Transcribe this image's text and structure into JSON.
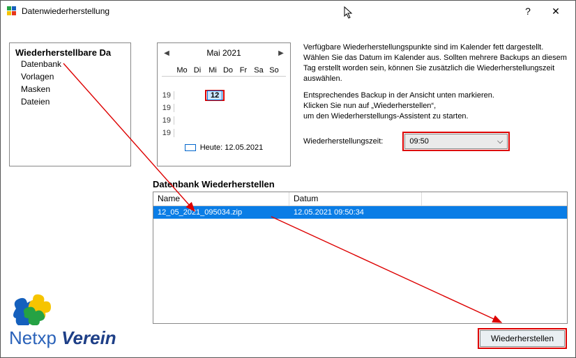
{
  "window": {
    "title": "Datenwiederherstellung",
    "help_symbol": "?",
    "close_symbol": "✕"
  },
  "tree": {
    "title": "Wiederherstellbare Da",
    "items": [
      "Datenbank",
      "Vorlagen",
      "Masken",
      "Dateien"
    ]
  },
  "calendar": {
    "month_label": "Mai 2021",
    "day_headers": [
      "Mo",
      "Di",
      "Mi",
      "Do",
      "Fr",
      "Sa",
      "So"
    ],
    "week_numbers": [
      "",
      "19",
      "19",
      "19",
      "19",
      ""
    ],
    "today_day": "12",
    "footer_label": "Heute: 12.05.2021"
  },
  "info": {
    "p1": "Verfügbare Wiederherstellungspunkte sind im Kalender fett dargestellt. Wählen Sie das Datum im Kalender aus. Sollten mehrere Backups an diesem Tag erstellt worden sein, können Sie zusätzlich die Wiederherstellungszeit auswählen.",
    "p2a": "Entsprechendes Backup in der Ansicht unten markieren.",
    "p2b": "Klicken Sie nun auf „Wiederherstellen“,",
    "p2c": "um den Wiederherstellungs-Assistent zu starten."
  },
  "time": {
    "label": "Wiederherstellungszeit:",
    "value": "09:50"
  },
  "section": {
    "title": "Datenbank Wiederherstellen"
  },
  "table": {
    "col1": "Name",
    "col2": "Datum",
    "rows": [
      {
        "name": "12_05_2021_095034.zip",
        "date": "12.05.2021 09:50:34"
      }
    ]
  },
  "restore_button": "Wiederherstellen",
  "logo": {
    "part1": "Netxp",
    "part2": "Verein"
  }
}
